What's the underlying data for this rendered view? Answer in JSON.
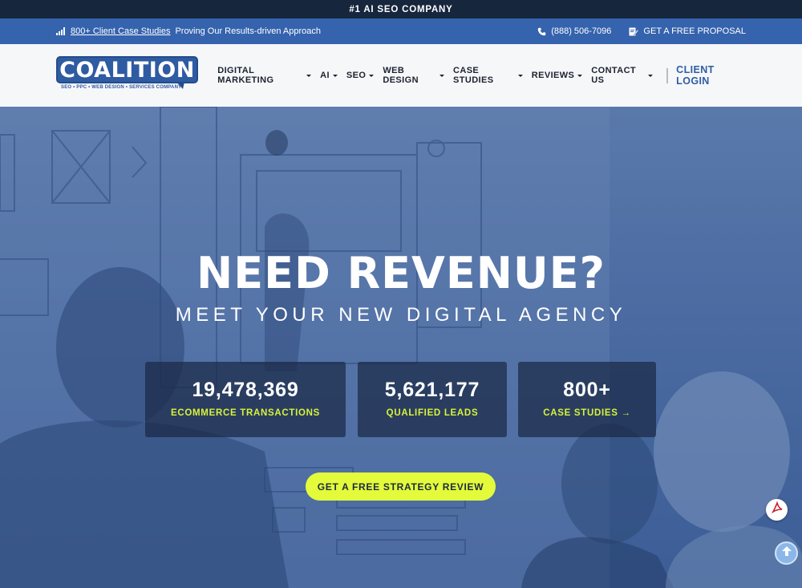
{
  "topbar": {
    "text": "#1 AI SEO COMPANY"
  },
  "infobar": {
    "link_text": "800+ Client Case Studies",
    "tagline": "Proving Our Results-driven Approach",
    "phone": "(888) 506-7096",
    "proposal": "GET A FREE PROPOSAL"
  },
  "logo": {
    "word": "COALITION",
    "tagline": "SEO • PPC • WEB DESIGN • SERVICES COMPANY"
  },
  "nav": {
    "items": [
      {
        "label": "DIGITAL MARKETING"
      },
      {
        "label": "AI"
      },
      {
        "label": "SEO"
      },
      {
        "label": "WEB DESIGN"
      },
      {
        "label": "CASE STUDIES"
      },
      {
        "label": "REVIEWS"
      },
      {
        "label": "CONTACT US"
      }
    ],
    "login": "CLIENT LOGIN"
  },
  "hero": {
    "headline": "NEED REVENUE?",
    "subline": "MEET YOUR NEW DIGITAL AGENCY",
    "stats": [
      {
        "number": "19,478,369",
        "label": "ECOMMERCE TRANSACTIONS"
      },
      {
        "number": "5,621,177",
        "label": "QUALIFIED LEADS"
      },
      {
        "number": "800+",
        "label": "CASE STUDIES →"
      }
    ],
    "cta": "GET A FREE STRATEGY REVIEW"
  },
  "colors": {
    "topbar": "#16263d",
    "infobar": "#3563ad",
    "brand_blue": "#2f5ba2",
    "accent_lime": "#e3fb3a"
  },
  "icons": [
    "signal-bars-icon",
    "phone-icon",
    "document-pen-icon",
    "chevron-down-icon",
    "pdf-icon",
    "arrow-up-icon"
  ]
}
